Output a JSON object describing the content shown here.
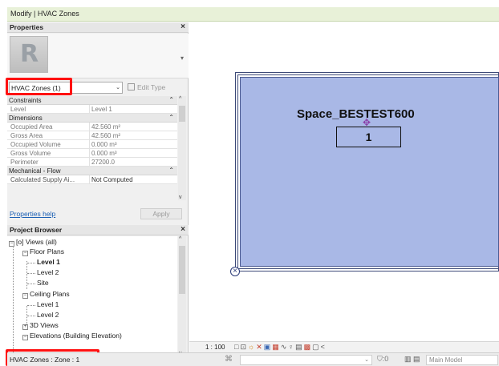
{
  "ribbon": {
    "context_title": "Modify | HVAC Zones"
  },
  "properties": {
    "title": "Properties",
    "type_selector": {
      "value": "HVAC Zones (1)"
    },
    "edit_type_label": "Edit Type",
    "groups": [
      {
        "name": "Constraints",
        "rows": [
          {
            "key": "Level",
            "value": "Level 1"
          }
        ]
      },
      {
        "name": "Dimensions",
        "rows": [
          {
            "key": "Occupied Area",
            "value": "42.560 m²"
          },
          {
            "key": "Gross Area",
            "value": "42.560 m²"
          },
          {
            "key": "Occupied Volume",
            "value": "0.000 m³"
          },
          {
            "key": "Gross Volume",
            "value": "0.000 m³"
          },
          {
            "key": "Perimeter",
            "value": "27200.0"
          }
        ]
      },
      {
        "name": "Mechanical - Flow",
        "rows": [
          {
            "key": "Calculated Supply Ai...",
            "value": "Not Computed"
          }
        ]
      }
    ],
    "help_link": "Properties help",
    "apply_label": "Apply"
  },
  "project_browser": {
    "title": "Project Browser",
    "root": "Views (all)",
    "nodes": [
      {
        "label": "Floor Plans"
      },
      {
        "label": "Level 1"
      },
      {
        "label": "Level 2"
      },
      {
        "label": "Site"
      },
      {
        "label": "Ceiling Plans"
      },
      {
        "label": "Level 1"
      },
      {
        "label": "Level 2"
      },
      {
        "label": "3D Views"
      },
      {
        "label": "Elevations (Building Elevation)"
      }
    ]
  },
  "canvas": {
    "space_label": "Space_BESTEST600",
    "space_number": "1",
    "zone_fill_color": "#a9b8e6"
  },
  "view_control": {
    "scale": "1 : 100"
  },
  "status_bar": {
    "selection_text": "HVAC Zones : Zone : 1",
    "filter_count": ":0",
    "model_label": "Main Model"
  },
  "highlight_color": "#ff1111"
}
